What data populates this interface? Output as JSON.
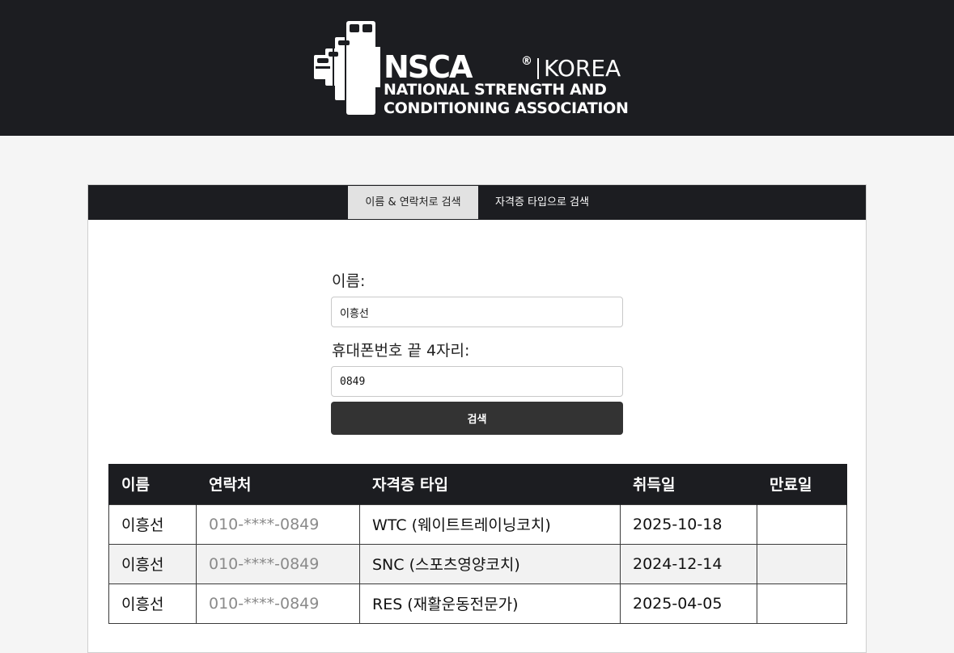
{
  "header": {
    "logo_brand": "NSCA",
    "logo_reg": "®",
    "logo_region": "KOREA",
    "logo_line1": "NATIONAL STRENGTH AND",
    "logo_line2": "CONDITIONING ASSOCIATION"
  },
  "tabs": [
    {
      "label": "이름 & 연락처로 검색",
      "active": true
    },
    {
      "label": "자격증 타입으로 검색",
      "active": false
    }
  ],
  "form": {
    "name_label": "이름:",
    "name_value": "이흥선",
    "phone_label": "휴대폰번호 끝 4자리:",
    "phone_value": "0849",
    "search_label": "검색"
  },
  "table": {
    "headers": [
      "이름",
      "연락처",
      "자격증 타입",
      "취득일",
      "만료일"
    ],
    "rows": [
      [
        "이흥선",
        "010-****-0849",
        "WTC (웨이트트레이닝코치)",
        "2025-10-18",
        ""
      ],
      [
        "이흥선",
        "010-****-0849",
        "SNC (스포츠영양코치)",
        "2024-12-14",
        ""
      ],
      [
        "이흥선",
        "010-****-0849",
        "RES (재활운동전문가)",
        "2025-04-05",
        ""
      ]
    ]
  },
  "colors": {
    "header_bg": "#1c1d21",
    "active_tab_bg": "#e2e2e2",
    "button_bg": "#333333",
    "page_bg": "#f5f5f5"
  }
}
